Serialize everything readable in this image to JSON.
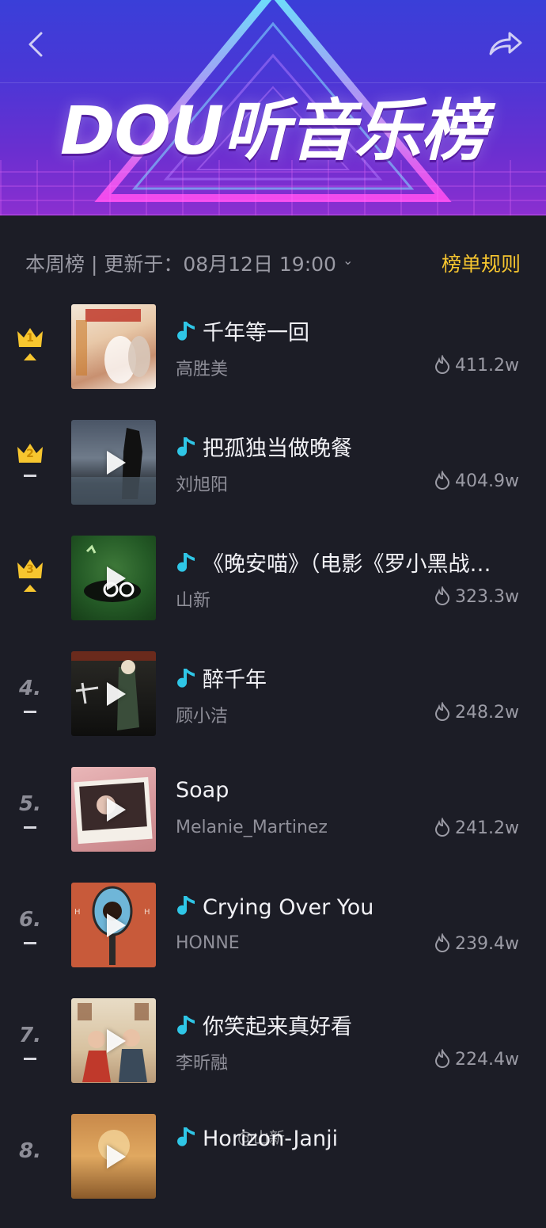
{
  "banner": {
    "title": "DOU听音乐榜",
    "back_icon": "chevron-left-icon",
    "share_icon": "share-arrow-icon"
  },
  "subheader": {
    "week_label": "本周榜 | 更新于：08月12日 19:00",
    "rules_label": "榜单规则"
  },
  "colors": {
    "accent": "#f7c62f",
    "background": "#1c1d26",
    "music_note": "#2fc6e6"
  },
  "songs": [
    {
      "rank": "1",
      "title": "千年等一回",
      "artist": "高胜美",
      "heat": "411.2w",
      "trend": "up",
      "has_note": true
    },
    {
      "rank": "2",
      "title": "把孤独当做晚餐",
      "artist": "刘旭阳",
      "heat": "404.9w",
      "trend": "flat",
      "has_note": true
    },
    {
      "rank": "3",
      "title": "《晚安喵》（电影《罗小黑战…",
      "artist": "山新",
      "heat": "323.3w",
      "trend": "up",
      "has_note": true
    },
    {
      "rank": "4.",
      "title": "醉千年",
      "artist": "顾小洁",
      "heat": "248.2w",
      "trend": "flat",
      "has_note": true
    },
    {
      "rank": "5.",
      "title": "Soap",
      "artist": "Melanie_Martinez",
      "heat": "241.2w",
      "trend": "flat",
      "has_note": false
    },
    {
      "rank": "6.",
      "title": "Crying Over You",
      "artist": "HONNE",
      "heat": "239.4w",
      "trend": "flat",
      "has_note": true
    },
    {
      "rank": "7.",
      "title": "你笑起来真好看",
      "artist": "李昕融",
      "heat": "224.4w",
      "trend": "flat",
      "has_note": true
    },
    {
      "rank": "8.",
      "title": "Horizon-Janji",
      "artist": "",
      "heat": "",
      "trend": "",
      "has_note": true
    }
  ],
  "watermark": "@山新"
}
